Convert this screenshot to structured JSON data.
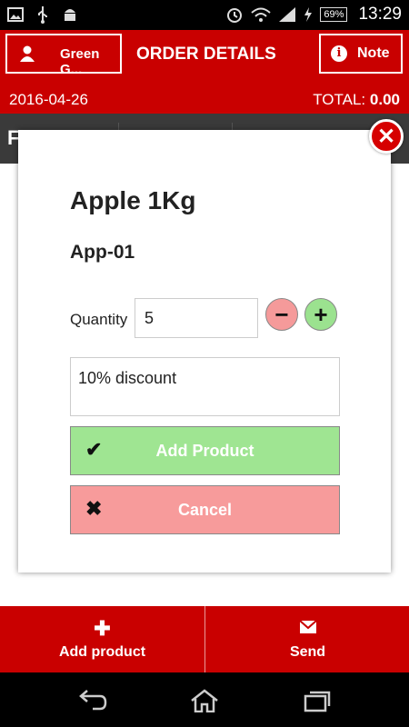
{
  "status_bar": {
    "time": "13:29",
    "battery": "69%",
    "icons": [
      "image-icon",
      "usb-icon",
      "android-icon",
      "alarm-icon",
      "wifi-icon",
      "signal-icon",
      "charging-icon"
    ]
  },
  "header": {
    "customer_label": "Green G...",
    "title": "ORDER DETAILS",
    "note_label": "Note",
    "date": "2016-04-26",
    "total_label": "TOTAL:",
    "total_value": "0.00"
  },
  "tab_strip": {
    "partial_label": "F"
  },
  "dialog": {
    "product_name": "Apple 1Kg",
    "product_code": "App-01",
    "quantity_label": "Quantity",
    "quantity_value": "5",
    "minus_symbol": "−",
    "plus_symbol": "+",
    "note_value": "10% discount",
    "add_label": "Add Product",
    "cancel_label": "Cancel",
    "close_symbol": "✕"
  },
  "bottom_bar": {
    "add_product_label": "Add product",
    "send_label": "Send"
  },
  "colors": {
    "primary": "#c90000",
    "add_green": "#9fe592",
    "cancel_red": "#f79b9b"
  }
}
